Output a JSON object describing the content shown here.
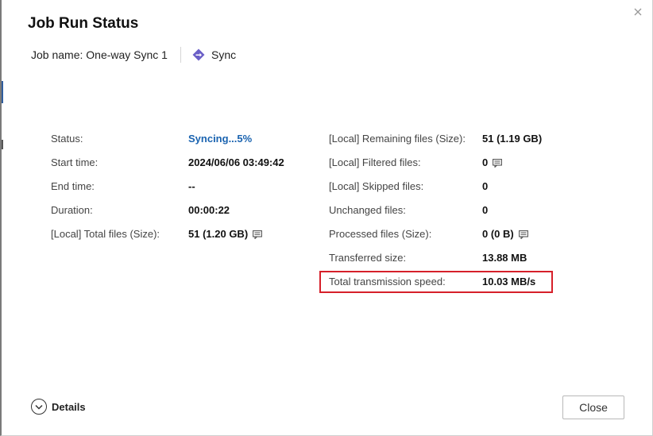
{
  "dialog": {
    "title": "Job Run Status",
    "job_name_label": "Job name: One-way Sync 1",
    "job_type": "Sync"
  },
  "left_details": [
    {
      "label": "Status:",
      "value": "Syncing...5%",
      "style": "status"
    },
    {
      "label": "Start time:",
      "value": "2024/06/06 03:49:42"
    },
    {
      "label": "End time:",
      "value": "--"
    },
    {
      "label": "Duration:",
      "value": "00:00:22"
    },
    {
      "label": "[Local] Total files (Size):",
      "value": "51 (1.20 GB)",
      "icon": "note-icon"
    }
  ],
  "right_details": [
    {
      "label": "[Local] Remaining files (Size):",
      "value": "51 (1.19 GB)"
    },
    {
      "label": "[Local] Filtered files:",
      "value": "0",
      "icon": "note-icon"
    },
    {
      "label": "[Local] Skipped files:",
      "value": "0"
    },
    {
      "label": "Unchanged files:",
      "value": "0"
    },
    {
      "label": "Processed files (Size):",
      "value": "0 (0 B)",
      "icon": "note-icon"
    },
    {
      "label": "Transferred size:",
      "value": "13.88 MB"
    },
    {
      "label": "Total transmission speed:",
      "value": "10.03 MB/s",
      "highlighted": true
    }
  ],
  "footer": {
    "details_label": "Details",
    "close_label": "Close"
  },
  "icons": {
    "close": "close-icon",
    "sync": "sync-diamond-icon",
    "details": "chevron-down-circle-icon",
    "note": "note-icon"
  },
  "colors": {
    "status_text": "#1a63b0",
    "sync_icon": "#6b5fc7",
    "highlight_border": "#d6202a"
  }
}
